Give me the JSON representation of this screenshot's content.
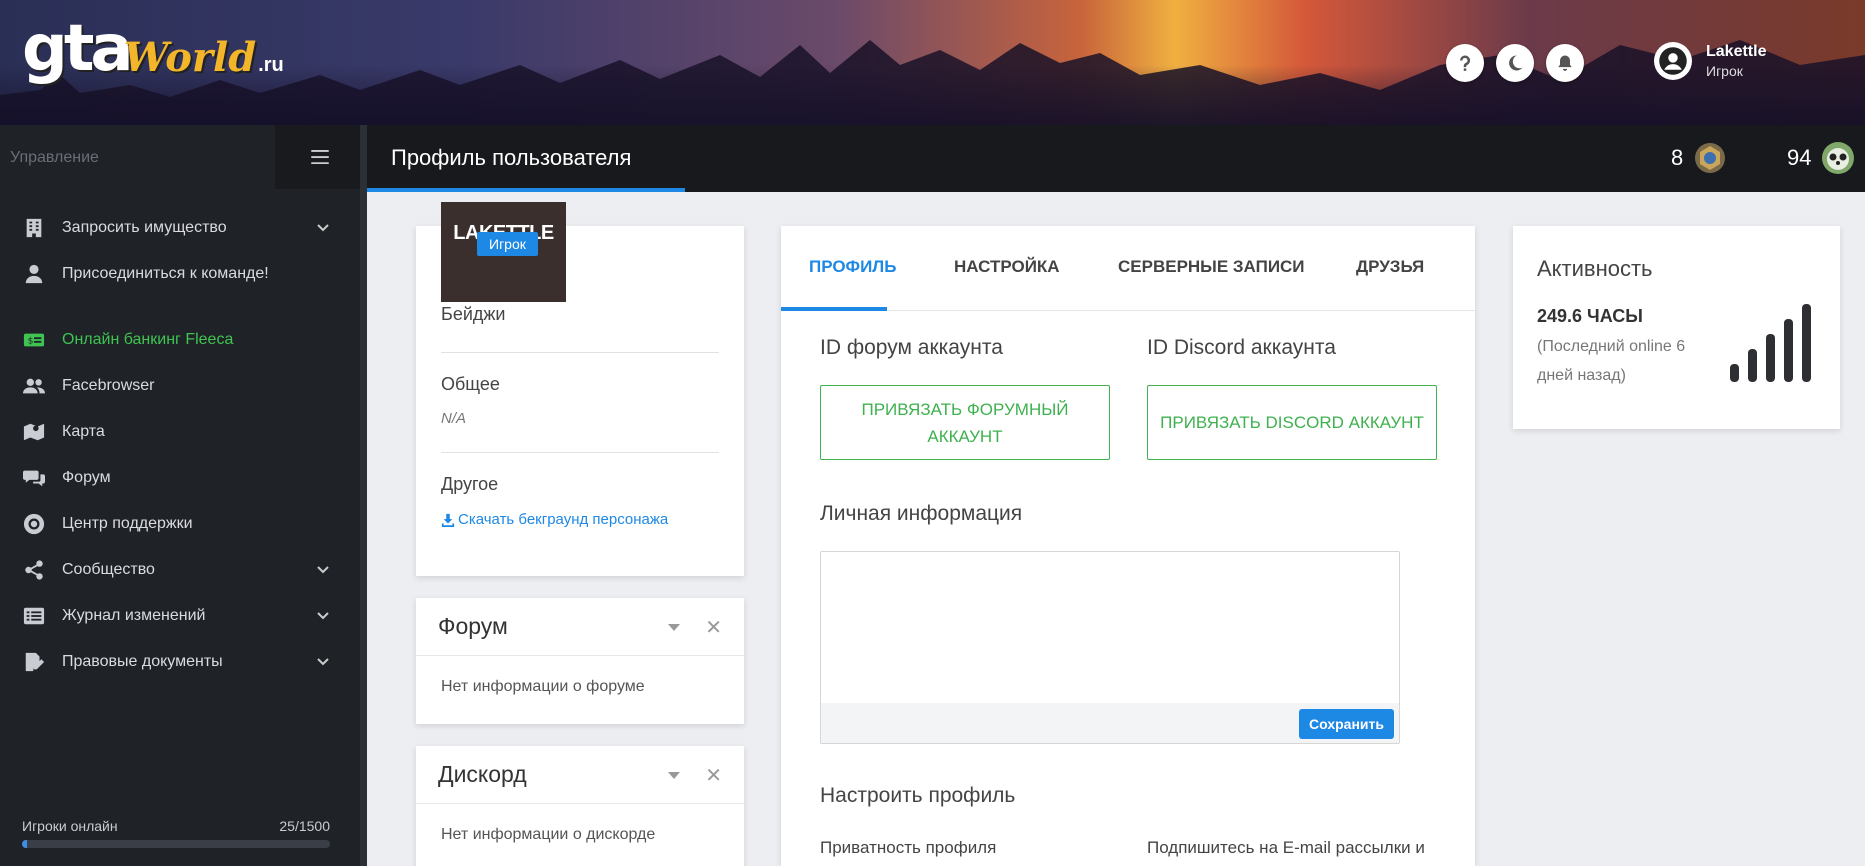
{
  "header": {
    "logo": {
      "gta": "gta",
      "world": "World",
      "ru": ".ru"
    },
    "buttons": [
      "question-icon",
      "moon-icon",
      "bell-icon"
    ],
    "user": {
      "name": "Lakettle",
      "role": "Игрок"
    }
  },
  "sidebar": {
    "manage_label": "Управление",
    "items": [
      {
        "label": "Запросить имущество",
        "icon": "building-icon",
        "expandable": true
      },
      {
        "label": "Присоединиться к команде!",
        "icon": "user-tie-icon",
        "expandable": false
      },
      {
        "label": "Онлайн банкинг Fleeca",
        "icon": "money-bill-icon",
        "expandable": false,
        "color": "#3fc451"
      },
      {
        "label": "Facebrowser",
        "icon": "users-icon",
        "expandable": false
      },
      {
        "label": "Карта",
        "icon": "map-icon",
        "expandable": false
      },
      {
        "label": "Форум",
        "icon": "comments-icon",
        "expandable": false
      },
      {
        "label": "Центр поддержки",
        "icon": "life-ring-icon",
        "expandable": false
      },
      {
        "label": "Сообщество",
        "icon": "share-icon",
        "expandable": true
      },
      {
        "label": "Журнал изменений",
        "icon": "list-icon",
        "expandable": true
      },
      {
        "label": "Правовые документы",
        "icon": "file-signature-icon",
        "expandable": true
      }
    ],
    "online": {
      "label": "Игроки онлайн",
      "value": "25/1500",
      "fraction": 0.0167
    }
  },
  "topbar": {
    "title": "Профиль пользователя",
    "counters": [
      {
        "value": "8",
        "icon": "medal-icon"
      },
      {
        "value": "94",
        "icon": "panda-avatar-icon"
      }
    ]
  },
  "profile": {
    "name": "LAKETTLE",
    "role": "Игрок",
    "badges_label": "Бейджи",
    "general_label": "Общее",
    "general_value": "N/A",
    "other_label": "Другое",
    "download_link": "Скачать бекграунд персонажа"
  },
  "forum_card": {
    "title": "Форум",
    "body": "Нет информации о форуме"
  },
  "discord_card": {
    "title": "Дискорд",
    "body": "Нет информации о дискорде"
  },
  "main": {
    "tabs": [
      "ПРОФИЛЬ",
      "НАСТРОЙКА",
      "СЕРВЕРНЫЕ ЗАПИСИ",
      "ДРУЗЬЯ"
    ],
    "active_tab": 0,
    "forum_id_label": "ID форум аккаунта",
    "forum_bind_button": "ПРИВЯЗАТЬ ФОРУМНЫЙ АККАУНТ",
    "discord_id_label": "ID Discord аккаунта",
    "discord_bind_button": "ПРИВЯЗАТЬ DISCORD АККАУНТ",
    "personal_info_label": "Личная информация",
    "personal_info_value": "",
    "save_button": "Сохранить",
    "customize_label": "Настроить профиль",
    "privacy_label": "Приватность профиля",
    "subscribe_label": "Подпишитесь на E-mail рассылки и"
  },
  "activity": {
    "title": "Активность",
    "hours": "249.6 ЧАСЫ",
    "last_online": "(Последний online 6 дней назад)",
    "signal_level": 5
  }
}
